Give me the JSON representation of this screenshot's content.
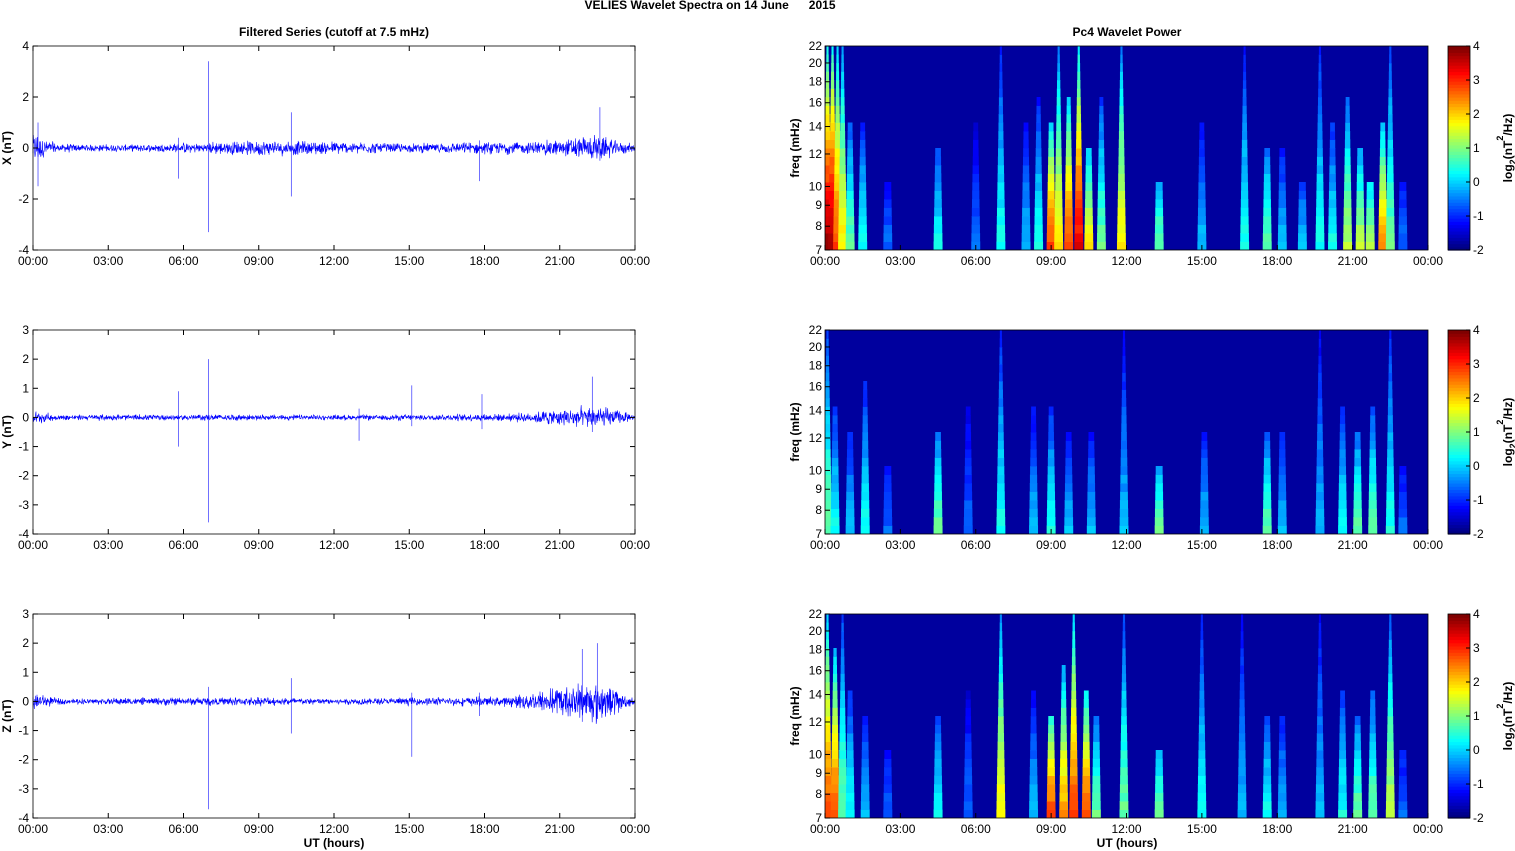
{
  "chart_data": {
    "title": "VELIES Wavelet Spectra on 14 June      2015",
    "left_title": "Filtered Series (cutoff at 7.5 mHz)",
    "right_title": "Pc4 Wavelet Power",
    "xlabel": "UT (hours)",
    "xticks": [
      "00:00",
      "03:00",
      "06:00",
      "09:00",
      "12:00",
      "15:00",
      "18:00",
      "21:00",
      "00:00"
    ],
    "xlim_hours": [
      0,
      24
    ],
    "series_color": "#0000ff",
    "time_series": [
      {
        "type": "line",
        "name": "X",
        "ylabel": "X (nT)",
        "ylim": [
          -4,
          4
        ],
        "yticks": [
          -4,
          -2,
          0,
          2,
          4
        ],
        "noise_profile": [
          [
            0,
            0.7
          ],
          [
            1,
            0.2
          ],
          [
            4,
            0.15
          ],
          [
            9,
            0.35
          ],
          [
            12,
            0.3
          ],
          [
            15,
            0.2
          ],
          [
            20,
            0.3
          ],
          [
            22.5,
            0.6
          ],
          [
            24,
            0.15
          ]
        ],
        "spikes": [
          [
            5.8,
            0.4,
            -1.2
          ],
          [
            7.0,
            3.4,
            -3.3
          ],
          [
            10.3,
            1.4,
            -1.9
          ],
          [
            17.8,
            0.3,
            -1.3
          ],
          [
            22.6,
            1.6,
            -0.5
          ],
          [
            0.2,
            1.0,
            -1.5
          ]
        ]
      },
      {
        "type": "line",
        "name": "Y",
        "ylabel": "Y (nT)",
        "ylim": [
          -4,
          3
        ],
        "yticks": [
          -4,
          -3,
          -2,
          -1,
          0,
          1,
          2,
          3
        ],
        "noise_profile": [
          [
            0,
            0.25
          ],
          [
            1,
            0.12
          ],
          [
            9,
            0.12
          ],
          [
            12,
            0.1
          ],
          [
            19,
            0.15
          ],
          [
            22.5,
            0.5
          ],
          [
            24,
            0.1
          ]
        ],
        "spikes": [
          [
            5.8,
            0.9,
            -1.0
          ],
          [
            7.0,
            2.0,
            -3.6
          ],
          [
            13.0,
            0.3,
            -0.8
          ],
          [
            15.1,
            1.1,
            -0.3
          ],
          [
            17.9,
            0.8,
            -0.4
          ],
          [
            22.3,
            1.4,
            -0.5
          ]
        ]
      },
      {
        "type": "line",
        "name": "Z",
        "ylabel": "Z (nT)",
        "ylim": [
          -4,
          3
        ],
        "yticks": [
          -4,
          -3,
          -2,
          -1,
          0,
          1,
          2,
          3
        ],
        "noise_profile": [
          [
            0,
            0.35
          ],
          [
            1,
            0.12
          ],
          [
            9,
            0.18
          ],
          [
            12,
            0.12
          ],
          [
            19,
            0.2
          ],
          [
            22.5,
            0.9
          ],
          [
            24,
            0.1
          ]
        ],
        "spikes": [
          [
            7.0,
            0.5,
            -3.7
          ],
          [
            10.3,
            0.8,
            -1.1
          ],
          [
            15.1,
            0.3,
            -1.9
          ],
          [
            17.8,
            0.3,
            -0.5
          ],
          [
            21.9,
            1.8,
            -0.7
          ],
          [
            22.5,
            2.0,
            -0.6
          ]
        ]
      }
    ],
    "spectrograms": [
      {
        "type": "heatmap",
        "ylabel": "freq (mHz)",
        "yticks": [
          7,
          8,
          9,
          10,
          12,
          14,
          16,
          18,
          20,
          22
        ],
        "ylim": [
          7,
          22
        ],
        "clabel": "log2(nT2/Hz)",
        "clim": [
          -2,
          4
        ],
        "cticks": [
          -2,
          -1,
          0,
          1,
          2,
          3,
          4
        ],
        "streaks": [
          [
            0.1,
            4,
            22
          ],
          [
            0.3,
            4,
            22
          ],
          [
            0.5,
            3,
            22
          ],
          [
            0.7,
            2,
            22
          ],
          [
            1.0,
            1,
            14
          ],
          [
            1.5,
            0.5,
            14
          ],
          [
            2.5,
            -0.5,
            10
          ],
          [
            4.5,
            0.5,
            12
          ],
          [
            6.0,
            -0.5,
            14
          ],
          [
            7.0,
            0.5,
            22
          ],
          [
            8.0,
            0,
            14
          ],
          [
            8.5,
            0.5,
            16
          ],
          [
            9.0,
            3,
            14
          ],
          [
            9.3,
            2,
            22
          ],
          [
            9.7,
            3,
            16
          ],
          [
            10.1,
            3.5,
            22
          ],
          [
            10.5,
            2,
            12
          ],
          [
            11.0,
            1,
            16
          ],
          [
            11.8,
            2,
            22
          ],
          [
            13.3,
            1,
            10
          ],
          [
            15.0,
            0,
            14
          ],
          [
            16.7,
            0.5,
            22
          ],
          [
            17.6,
            1,
            12
          ],
          [
            18.2,
            0,
            12
          ],
          [
            19.0,
            0,
            10
          ],
          [
            19.7,
            0.5,
            22
          ],
          [
            20.2,
            0.5,
            14
          ],
          [
            20.8,
            1.5,
            16
          ],
          [
            21.3,
            1.5,
            12
          ],
          [
            21.7,
            1.5,
            10
          ],
          [
            22.2,
            2.5,
            14
          ],
          [
            22.5,
            1,
            22
          ],
          [
            23.0,
            -0.5,
            10
          ]
        ]
      },
      {
        "type": "heatmap",
        "ylabel": "freq (mHz)",
        "yticks": [
          7,
          8,
          9,
          10,
          12,
          14,
          16,
          18,
          20,
          22
        ],
        "ylim": [
          7,
          22
        ],
        "clabel": "log2(nT2/Hz)",
        "clim": [
          -2,
          4
        ],
        "cticks": [
          -2,
          -1,
          0,
          1,
          2,
          3,
          4
        ],
        "streaks": [
          [
            0.1,
            1,
            22
          ],
          [
            0.4,
            0.5,
            14
          ],
          [
            1.0,
            0,
            12
          ],
          [
            1.6,
            0.5,
            16
          ],
          [
            2.5,
            -0.5,
            10
          ],
          [
            4.5,
            1,
            12
          ],
          [
            5.7,
            -0.5,
            14
          ],
          [
            7.0,
            0.5,
            22
          ],
          [
            8.3,
            0,
            14
          ],
          [
            9.0,
            0.5,
            14
          ],
          [
            9.7,
            0,
            12
          ],
          [
            10.6,
            0,
            12
          ],
          [
            11.9,
            0,
            22
          ],
          [
            13.3,
            1,
            10
          ],
          [
            15.1,
            0,
            12
          ],
          [
            17.6,
            1,
            12
          ],
          [
            18.2,
            0,
            12
          ],
          [
            19.7,
            0,
            22
          ],
          [
            20.6,
            0.5,
            14
          ],
          [
            21.2,
            1,
            12
          ],
          [
            21.8,
            1,
            14
          ],
          [
            22.5,
            0.5,
            22
          ],
          [
            23.0,
            -0.5,
            10
          ]
        ]
      },
      {
        "type": "heatmap",
        "ylabel": "freq (mHz)",
        "yticks": [
          7,
          8,
          9,
          10,
          12,
          14,
          16,
          18,
          20,
          22
        ],
        "ylim": [
          7,
          22
        ],
        "clabel": "log2(nT2/Hz)",
        "clim": [
          -2,
          4
        ],
        "cticks": [
          -2,
          -1,
          0,
          1,
          2,
          3,
          4
        ],
        "streaks": [
          [
            0.1,
            3,
            22
          ],
          [
            0.4,
            3,
            18
          ],
          [
            0.7,
            1,
            22
          ],
          [
            1.0,
            0.5,
            14
          ],
          [
            1.6,
            0,
            12
          ],
          [
            2.5,
            -0.5,
            10
          ],
          [
            4.5,
            0.5,
            12
          ],
          [
            5.7,
            -0.5,
            14
          ],
          [
            7.0,
            2,
            22
          ],
          [
            8.3,
            0,
            14
          ],
          [
            9.0,
            3,
            12
          ],
          [
            9.5,
            2.5,
            16
          ],
          [
            9.9,
            3,
            22
          ],
          [
            10.4,
            3,
            14
          ],
          [
            10.8,
            1,
            12
          ],
          [
            11.9,
            1,
            22
          ],
          [
            13.3,
            1,
            10
          ],
          [
            15.0,
            0.5,
            22
          ],
          [
            16.6,
            0,
            22
          ],
          [
            17.6,
            0.5,
            12
          ],
          [
            18.2,
            0,
            12
          ],
          [
            19.7,
            0,
            22
          ],
          [
            20.6,
            0.5,
            14
          ],
          [
            21.2,
            1,
            12
          ],
          [
            21.8,
            1,
            14
          ],
          [
            22.5,
            1.5,
            22
          ],
          [
            23.0,
            -0.5,
            10
          ]
        ]
      }
    ]
  }
}
